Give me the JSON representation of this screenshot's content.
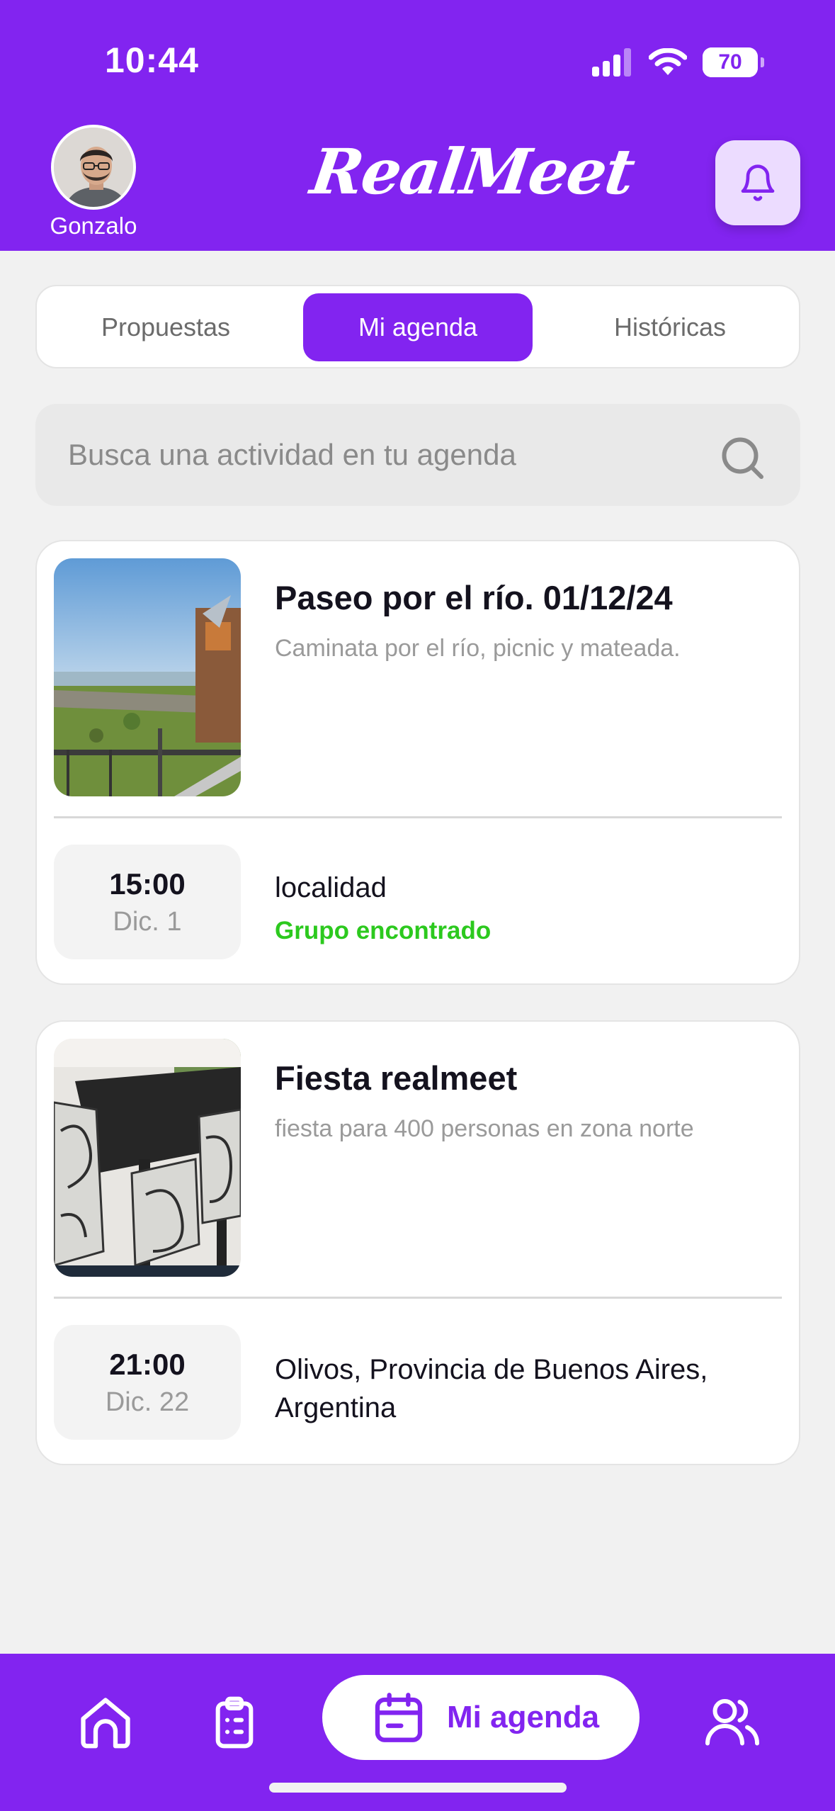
{
  "status_bar": {
    "time": "10:44",
    "battery_level": "70"
  },
  "header": {
    "user_name": "Gonzalo",
    "brand": "RealMeet"
  },
  "tabs": [
    {
      "label": "Propuestas",
      "active": false
    },
    {
      "label": "Mi agenda",
      "active": true
    },
    {
      "label": "Históricas",
      "active": false
    }
  ],
  "search": {
    "placeholder": "Busca una actividad en tu agenda",
    "value": ""
  },
  "activities": [
    {
      "title": "Paseo por el río. 01/12/24",
      "description": "Caminata por el río, picnic y mateada.",
      "time": "15:00",
      "day": "Dic. 1",
      "location": "localidad",
      "status": "Grupo encontrado"
    },
    {
      "title": "Fiesta realmeet",
      "description": "fiesta para 400 personas en zona norte",
      "time": "21:00",
      "day": "Dic. 22",
      "location": "Olivos, Provincia de Buenos Aires, Argentina",
      "status": ""
    }
  ],
  "bottom_nav": {
    "items": [
      {
        "icon": "home-icon"
      },
      {
        "icon": "clipboard-icon"
      },
      {
        "icon": "calendar-icon",
        "label": "Mi agenda",
        "active": true
      },
      {
        "icon": "users-icon"
      }
    ]
  },
  "colors": {
    "primary": "#8224f0",
    "bell_bg": "#ecdcff",
    "status_green": "#2cc91e",
    "background": "#f1f1f1"
  }
}
